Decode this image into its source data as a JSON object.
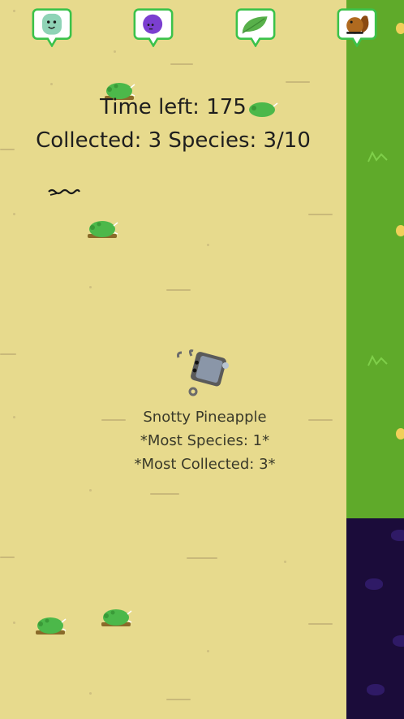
{
  "hud": {
    "time_text": "Time left: 175",
    "stats_text": "Collected: 3  Species: 3/10"
  },
  "player": {
    "name": "Snotty Pineapple",
    "most_species": "*Most Species: 1*",
    "most_collected": "*Most Collected: 3*"
  },
  "species_bubbles": [
    {
      "icon": "green-face-creature-icon",
      "color": "#8fd3b6"
    },
    {
      "icon": "purple-blob-creature-icon",
      "color": "#7b3fd0"
    },
    {
      "icon": "leaf-icon",
      "color": "#58b04a"
    },
    {
      "icon": "brown-squirrel-creature-icon",
      "color": "#b06a1f"
    }
  ],
  "terrain": {
    "sand_color": "#e7da8d",
    "grass_color": "#5faa2a",
    "void_color": "#1b0c3a"
  }
}
